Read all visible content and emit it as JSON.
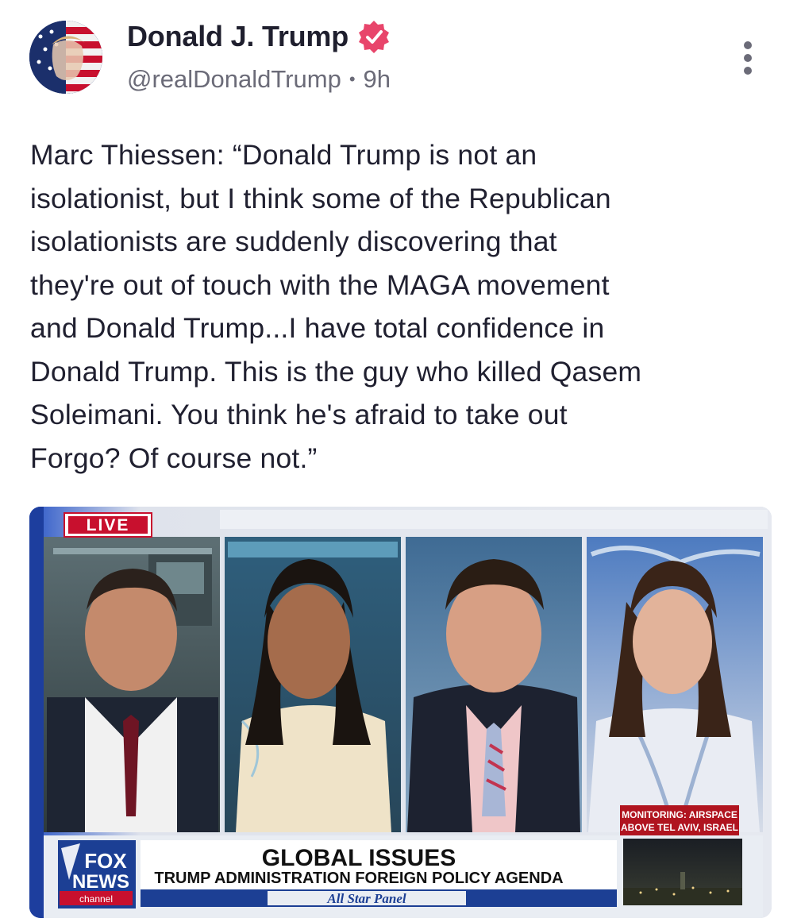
{
  "post": {
    "author_name": "Donald J. Trump",
    "handle": "@realDonaldTrump",
    "separator": "•",
    "time": "9h",
    "verified": true,
    "text_lines": [
      "Marc Thiessen: “Donald Trump is not an",
      "isolationist, but I think some of the Republican",
      "isolationists are suddenly discovering that",
      "they're out of touch with the MAGA movement",
      "and Donald Trump...I have total confidence in",
      "Donald Trump. This is the guy who killed Qasem",
      "Soleimani. You think he's afraid to take out",
      "Forgo? Of course not.”"
    ]
  },
  "media": {
    "live_badge": "LIVE",
    "network_logo_line1": "FOX",
    "network_logo_line2": "NEWS",
    "network_logo_line3": "channel",
    "headline": "GLOBAL ISSUES",
    "subheadline": "TRUMP ADMINISTRATION FOREIGN POLICY AGENDA",
    "panel_label": "All Star Panel",
    "monitor_line1": "MONITORING: AIRSPACE",
    "monitor_line2": "ABOVE TEL AVIV, ISRAEL"
  },
  "icons": {
    "verified": "verified-badge-icon",
    "more": "more-vertical-icon"
  },
  "colors": {
    "verified_badge": "#e8456b",
    "fox_blue": "#1c3f94",
    "live_red": "#c8102e"
  }
}
